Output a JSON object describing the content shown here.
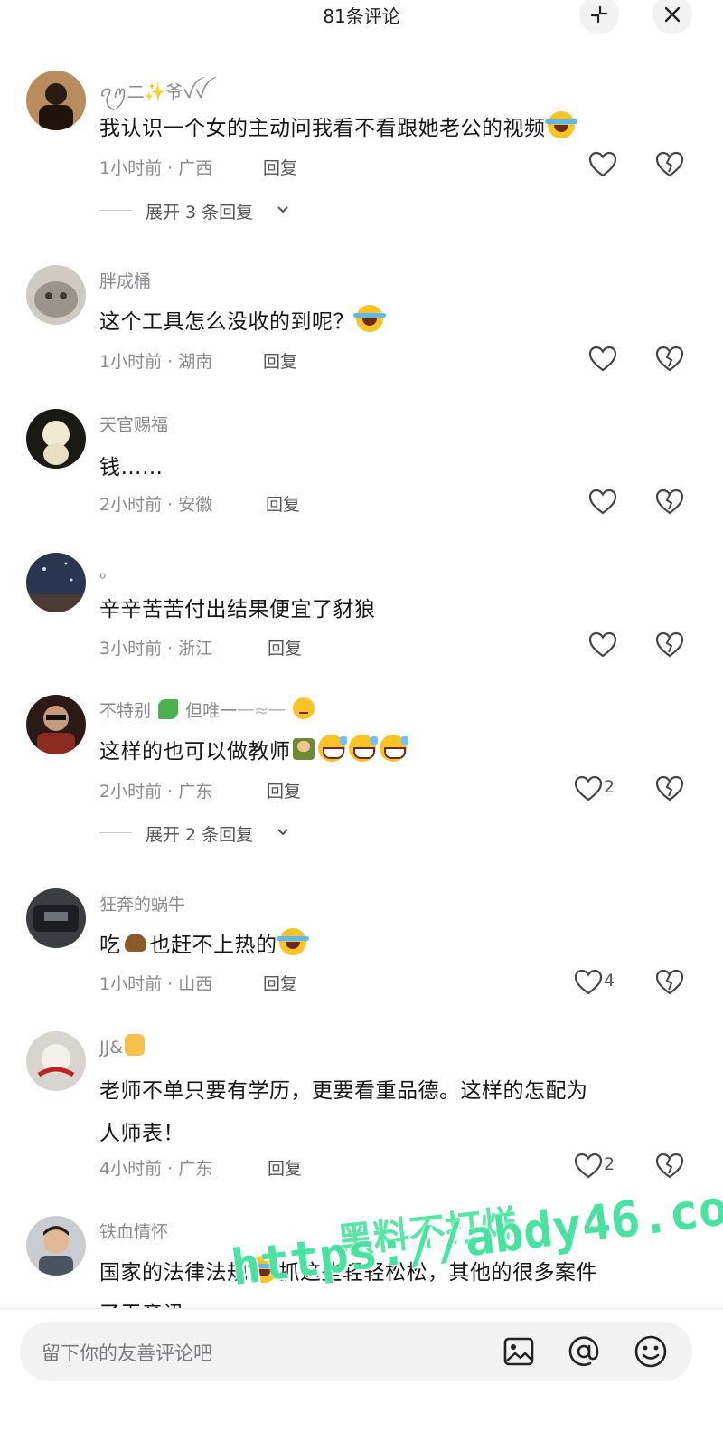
{
  "header": {
    "title": "81条评论"
  },
  "comments": [
    {
      "name": "ꪖꪑ二✨爷ꪜꪜ",
      "text": "我认识一个女的主动问我看不看跟她老公的视频",
      "time_location": "1小时前 · 广西",
      "reply_label": "回复",
      "likes": "",
      "expand": "展开 3 条回复"
    },
    {
      "name": "胖成桶",
      "text": "这个工具怎么没收的到呢？",
      "time_location": "1小时前 · 湖南",
      "reply_label": "回复",
      "likes": ""
    },
    {
      "name": "天官赐福",
      "text": "钱……",
      "time_location": "2小时前 · 安徽",
      "reply_label": "回复",
      "likes": ""
    },
    {
      "name": "。",
      "text": "辛辛苦苦付出结果便宜了豺狼",
      "time_location": "3小时前 · 浙江",
      "reply_label": "回复",
      "likes": ""
    },
    {
      "name_part1": "不特别",
      "name_part2": "但唯一",
      "name_part3": "一≈一",
      "text": "这样的也可以做教师",
      "time_location": "2小时前 · 广东",
      "reply_label": "回复",
      "likes": "2",
      "expand": "展开 2 条回复"
    },
    {
      "name": "狂奔的蜗牛",
      "text_part1": "吃",
      "text_part2": "也赶不上热的",
      "time_location": "1小时前 · 山西",
      "reply_label": "回复",
      "likes": "4"
    },
    {
      "name": "JJ&",
      "text_line1": "老师不单只要有学历，更要看重品德。这样的怎配为",
      "text_line2": "人师表！",
      "time_location": "4小时前 · 广东",
      "reply_label": "回复",
      "likes": "2"
    },
    {
      "name": "铁血情怀",
      "text_part1": "国家的法律法规",
      "text_part2": "抓这些轻轻松松，其他的很多案件",
      "text_line2": "了无音讯"
    }
  ],
  "watermark": {
    "line1": "黑料不打烊",
    "line2": "https://abdy46.com"
  },
  "composer": {
    "placeholder": "留下你的友善评论吧"
  },
  "icons": {
    "collapse": "collapse-icon",
    "close": "close-icon",
    "like": "heart-icon",
    "dislike": "broken-heart-icon",
    "chevron": "chevron-down-icon",
    "image": "image-icon",
    "mention": "at-icon",
    "emoji": "emoji-icon"
  }
}
